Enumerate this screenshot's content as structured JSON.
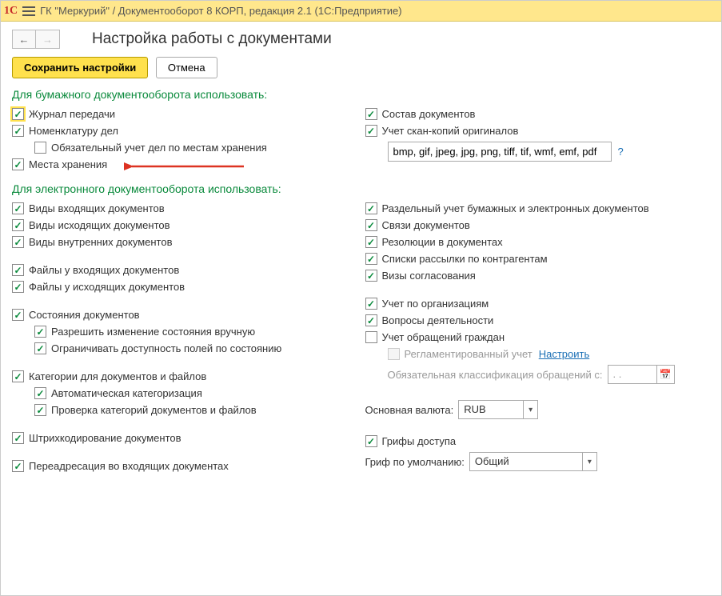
{
  "titlebar": {
    "app_text": "ГК \"Меркурий\" / Документооборот 8 КОРП, редакция 2.1  (1С:Предприятие)",
    "logo": "1C"
  },
  "page": {
    "title": "Настройка работы с документами",
    "save_label": "Сохранить настройки",
    "cancel_label": "Отмена"
  },
  "section_paper": {
    "header": "Для бумажного документооборота использовать:",
    "left": {
      "journal": "Журнал передачи",
      "nomenclature": "Номенклатуру дел",
      "mandatory_storage": "Обязательный учет дел по местам хранения",
      "storage_locations": "Места хранения"
    },
    "right": {
      "doc_composition": "Состав документов",
      "scan_copies": "Учет скан-копий оригиналов",
      "formats_value": "bmp, gif, jpeg, jpg, png, tiff, tif, wmf, emf, pdf",
      "help": "?"
    }
  },
  "section_electronic": {
    "header": "Для электронного документооборота использовать:",
    "left": {
      "incoming_types": "Виды входящих документов",
      "outgoing_types": "Виды исходящих документов",
      "internal_types": "Виды внутренних документов",
      "incoming_files": "Файлы у входящих документов",
      "outgoing_files": "Файлы у исходящих документов",
      "doc_states": "Состояния документов",
      "allow_manual_state": "Разрешить изменение состояния вручную",
      "restrict_by_state": "Ограничивать доступность полей по состоянию",
      "categories": "Категории для документов и файлов",
      "auto_categorization": "Автоматическая категоризация",
      "category_check": "Проверка категорий документов и файлов",
      "barcoding": "Штрихкодирование документов",
      "redirect_incoming": "Переадресация во входящих документах"
    },
    "right": {
      "separate_accounting": "Раздельный учет бумажных и электронных документов",
      "doc_links": "Связи документов",
      "resolutions": "Резолюции в документах",
      "mailing_lists": "Списки рассылки по контрагентам",
      "approval_visas": "Визы согласования",
      "by_org": "Учет по организациям",
      "activity_questions": "Вопросы деятельности",
      "citizen_appeals": "Учет обращений граждан",
      "regulated": "Регламентированный учет",
      "configure_link": "Настроить",
      "mandatory_class_label": "Обязательная классификация обращений с:",
      "date_placeholder": " .   .",
      "currency_label": "Основная валюта:",
      "currency_value": "RUB",
      "access_stamps": "Грифы доступа",
      "default_stamp_label": "Гриф по умолчанию:",
      "default_stamp_value": "Общий"
    }
  }
}
